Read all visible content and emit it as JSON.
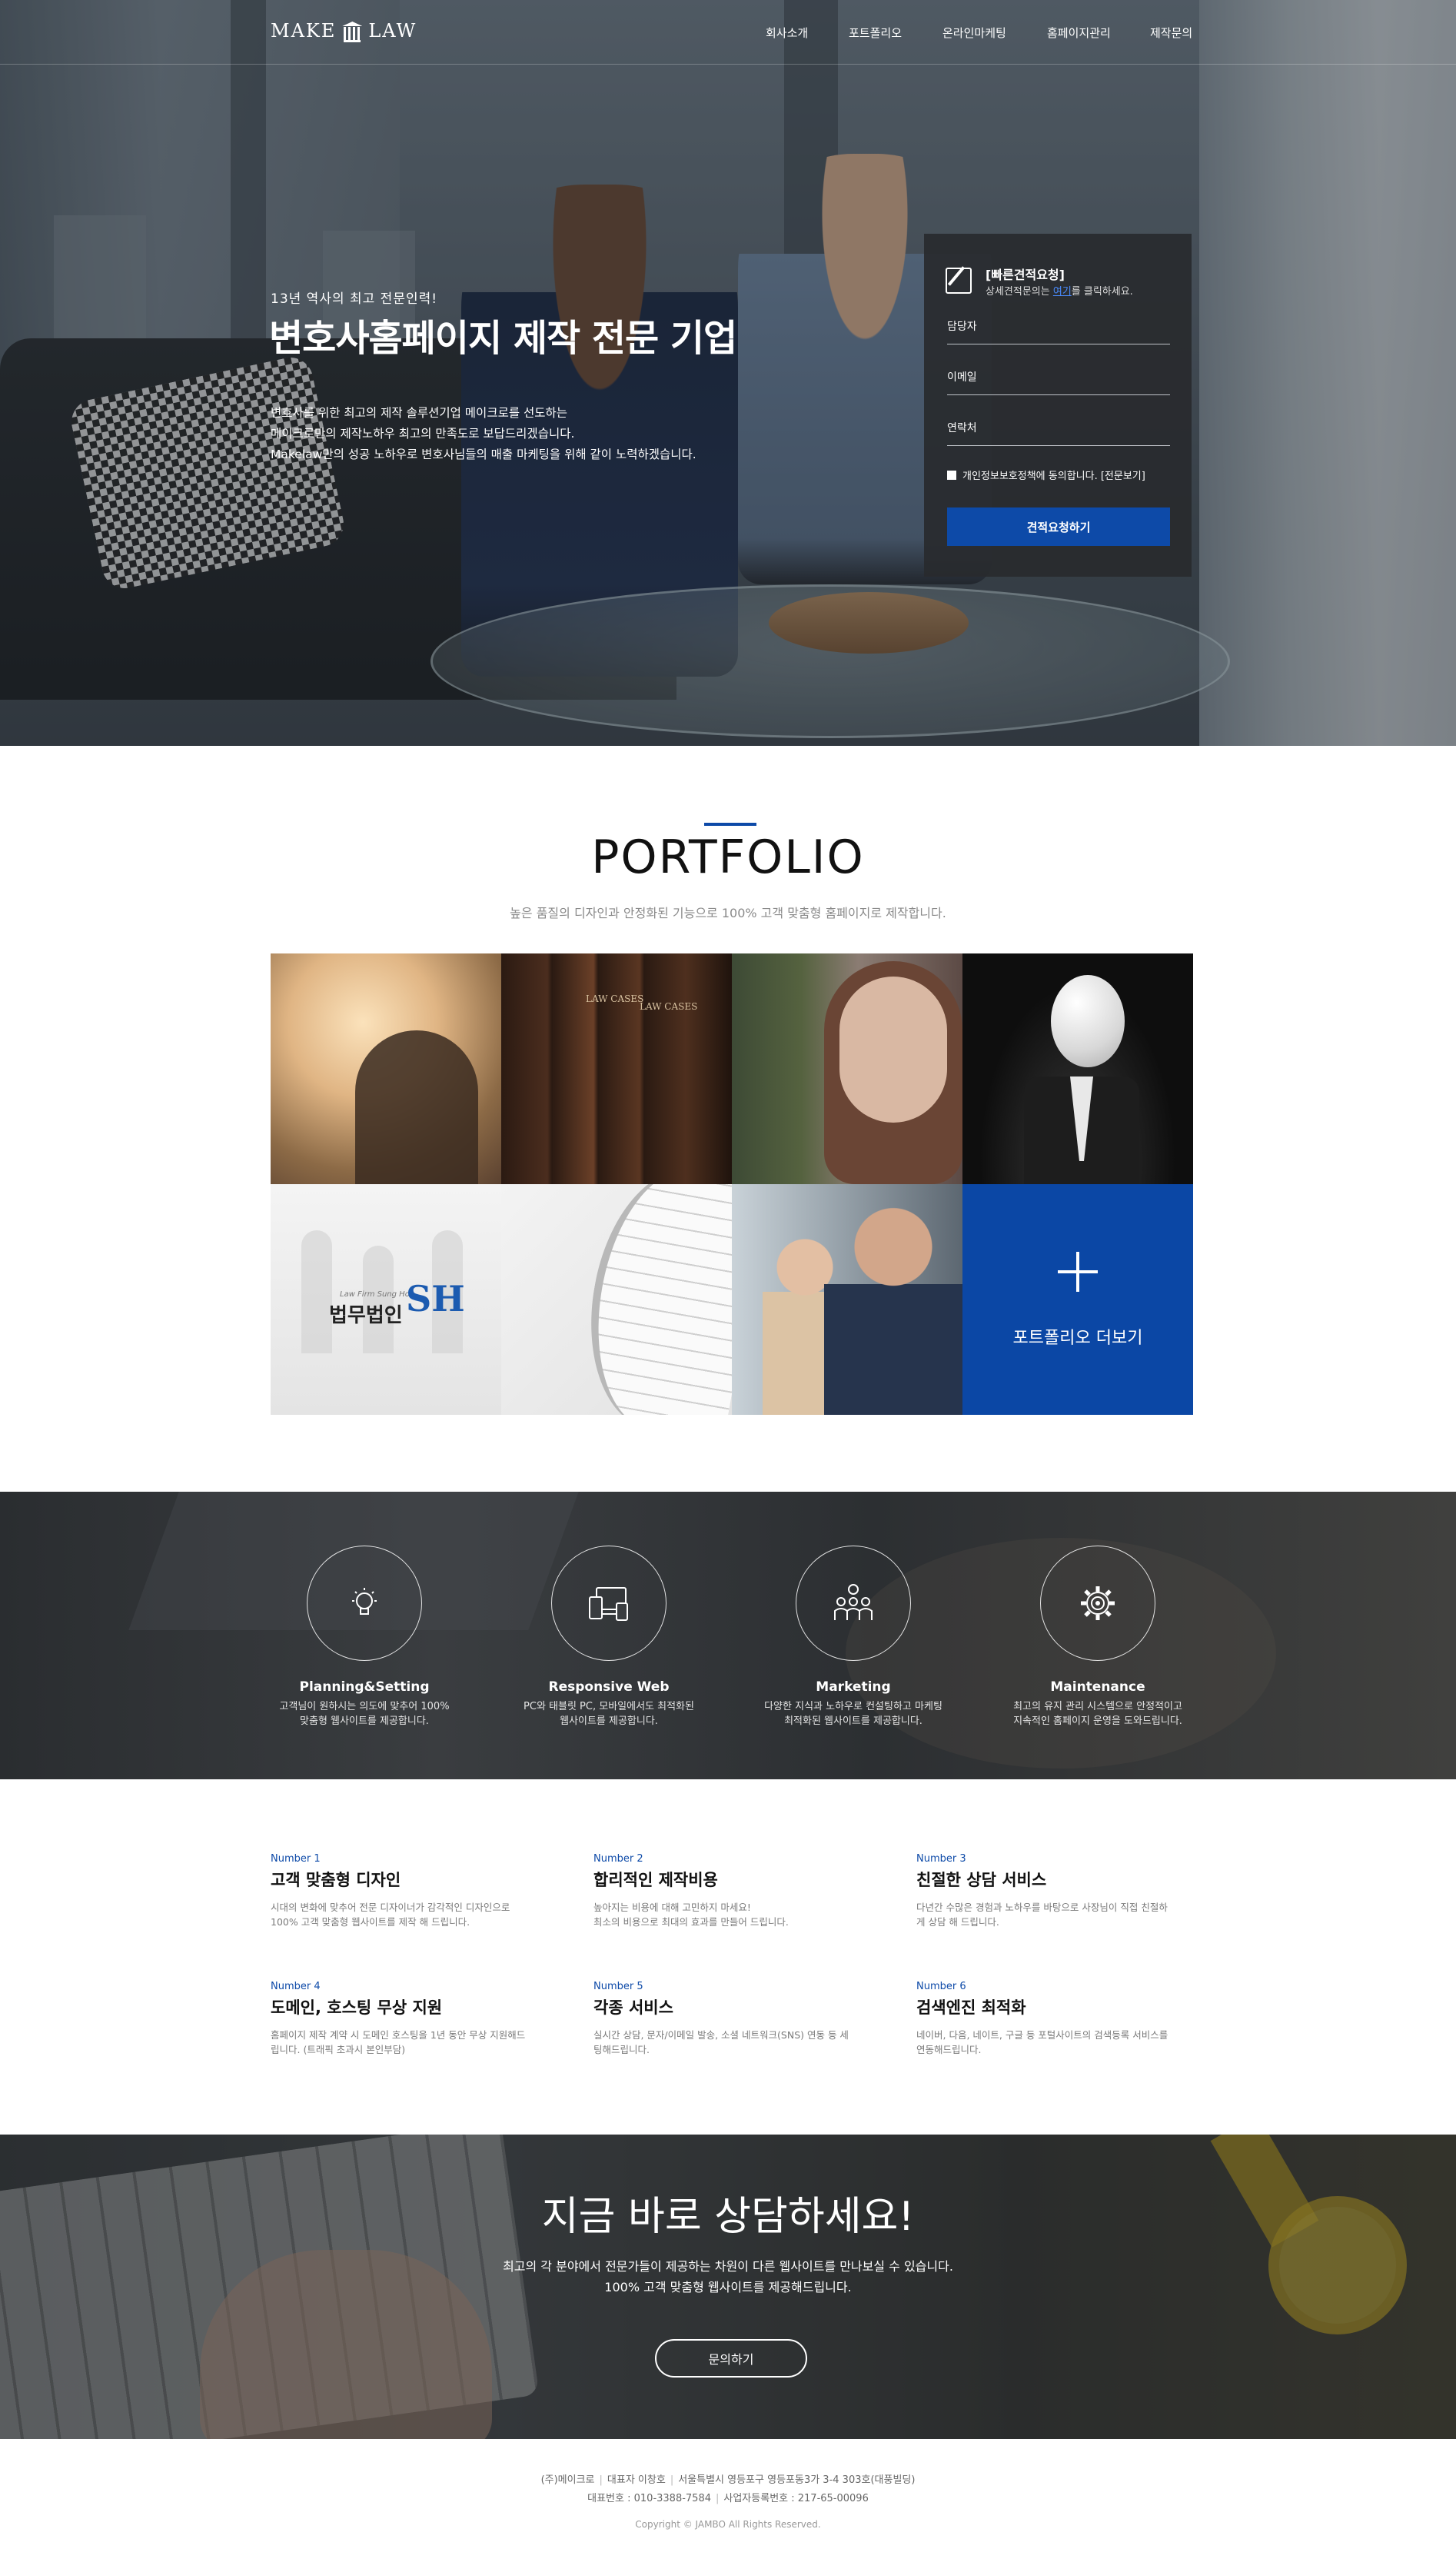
{
  "header": {
    "logo_left": "MAKE",
    "logo_right": "LAW",
    "nav": [
      "회사소개",
      "포트폴리오",
      "온라인마케팅",
      "홈페이지관리",
      "제작문의"
    ]
  },
  "hero": {
    "subtitle": "13년 역사의 최고 전문인력!",
    "title": "변호사홈페이지 제작 전문 기업",
    "desc": [
      "변호사를 위한 최고의 제작 솔루션기업 메이크로를 선도하는",
      "메이크로만의 제작노하우 최고의 만족도로 보답드리겠습니다.",
      "Makelaw만의 성공 노하우로 변호사님들의 매출 마케팅을 위해 같이 노력하겠습니다."
    ]
  },
  "quote_form": {
    "title": "[빠른견적요청]",
    "note_before": "상세견적문의는 ",
    "note_link": "여기",
    "note_after": "를 클릭하세요.",
    "fields": [
      "담당자",
      "이메일",
      "연락처"
    ],
    "agree": "개인정보보호정책에 동의합니다. [전문보기]",
    "submit": "견적요청하기"
  },
  "portfolio": {
    "title": "PORTFOLIO",
    "subtitle": "높은 품질의 디자인과 안정화된 기능으로 100% 고객 맞춤형 홈페이지로 제작합니다.",
    "book_label_1": "LAW CASES",
    "book_label_2": "LAW CASES",
    "law_firm_small": "Law Firm Sung Ho",
    "law_firm_name": "법무법인",
    "law_firm_mark": "SH",
    "more": "포트폴리오 더보기"
  },
  "services": [
    {
      "icon": "lightbulb-icon",
      "name": "Planning&Setting",
      "desc": [
        "고객님이 원하시는 의도에 맞추어 100%",
        "맞춤형 웹사이트를 제공합니다."
      ]
    },
    {
      "icon": "devices-icon",
      "name": "Responsive Web",
      "desc": [
        "PC와 태블릿 PC, 모바일에서도 최적화된",
        "웹사이트를 제공합니다."
      ]
    },
    {
      "icon": "team-icon",
      "name": "Marketing",
      "desc": [
        "다양한 지식과 노하우로 컨설팅하고 마케팅",
        "최적화된 웹사이트를 제공합니다."
      ]
    },
    {
      "icon": "gear-icon",
      "name": "Maintenance",
      "desc": [
        "최고의 유지 관리 시스템으로 안정적이고",
        "지속적인 홈페이지 운영을 도와드립니다."
      ]
    }
  ],
  "features": [
    {
      "num": "Number 1",
      "title": "고객 맞춤형 디자인",
      "text": [
        "시대의 변화에 맞추어 전문 디자이너가 감각적인 디자인으로",
        "100% 고객 맞춤형 웹사이트를 제작 해 드립니다."
      ]
    },
    {
      "num": "Number 2",
      "title": "합리적인 제작비용",
      "text": [
        "높아지는 비용에 대해 고민하지 마세요!",
        "최소의 비용으로 최대의 효과를 만들어 드립니다."
      ]
    },
    {
      "num": "Number 3",
      "title": "친절한 상담 서비스",
      "text": [
        "다년간 수많은 경험과 노하우를 바탕으로 사장님이 직접 친절하",
        "게 상담 해 드립니다."
      ]
    },
    {
      "num": "Number 4",
      "title": "도메인, 호스팅 무상 지원",
      "text": [
        "홈페이지 제작 계약 시 도메인 호스팅을 1년 동안 무상 지원해드",
        "립니다. (트래픽 초과시 본인부담)"
      ]
    },
    {
      "num": "Number 5",
      "title": "각종 서비스",
      "text": [
        "실시간 상담, 문자/이메일 발송, 소셜 네트워크(SNS) 연동 등 세",
        "팅해드립니다."
      ]
    },
    {
      "num": "Number 6",
      "title": "검색엔진 최적화",
      "text": [
        "네이버, 다음, 네이트, 구글 등 포털사이트의 검색등록 서비스를",
        "연동해드립니다."
      ]
    }
  ],
  "cta": {
    "title": "지금 바로 상담하세요!",
    "desc": [
      "최고의 각 분야에서 전문가들이 제공하는 차원이 다른 웹사이트를 만나보실 수 있습니다.",
      "100% 고객 맞춤형 웹사이트를 제공해드립니다."
    ],
    "button": "문의하기"
  },
  "footer": {
    "company": "(주)메이크로",
    "ceo": "대표자 이창호",
    "address": "서울특별시 영등포구 영등포동3가 3-4 303호(대풍빌딩)",
    "phone": "대표번호 : 010-3388-7584",
    "biz": "사업자등록번호 : 217-65-00096",
    "copyright": "Copyright © JAMBO All Rights Reserved."
  },
  "colors": {
    "accent": "#0d4aa8",
    "hero_overlay": "#1a1e24",
    "quote_bg": "#2a2c30"
  }
}
